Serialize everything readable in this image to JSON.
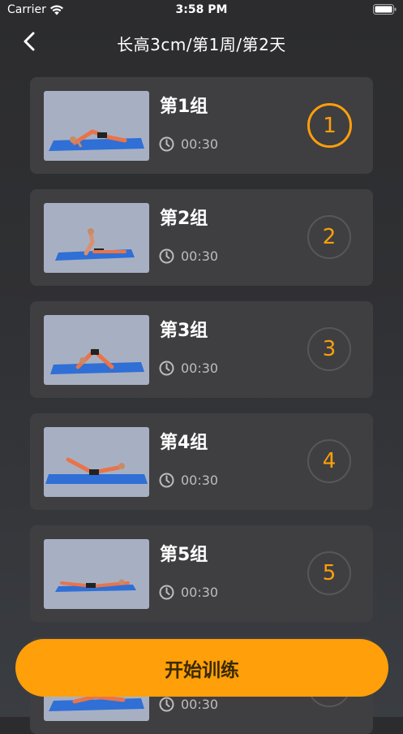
{
  "status_bar": {
    "carrier": "Carrier",
    "time": "3:58 PM"
  },
  "nav": {
    "title": "长高3cm/第1周/第2天"
  },
  "exercises": [
    {
      "name": "第1组",
      "duration": "00:30",
      "number": "1",
      "active": true
    },
    {
      "name": "第2组",
      "duration": "00:30",
      "number": "2",
      "active": false
    },
    {
      "name": "第3组",
      "duration": "00:30",
      "number": "3",
      "active": false
    },
    {
      "name": "第4组",
      "duration": "00:30",
      "number": "4",
      "active": false
    },
    {
      "name": "第5组",
      "duration": "00:30",
      "number": "5",
      "active": false
    },
    {
      "name": "",
      "duration": "00:30",
      "number": "",
      "active": false
    }
  ],
  "start_button": {
    "label": "开始训练"
  },
  "colors": {
    "accent": "#ff9f0a",
    "card": "#3f3f41",
    "thumb_bg": "#a7b0c3",
    "mat": "#2f6fd6"
  }
}
